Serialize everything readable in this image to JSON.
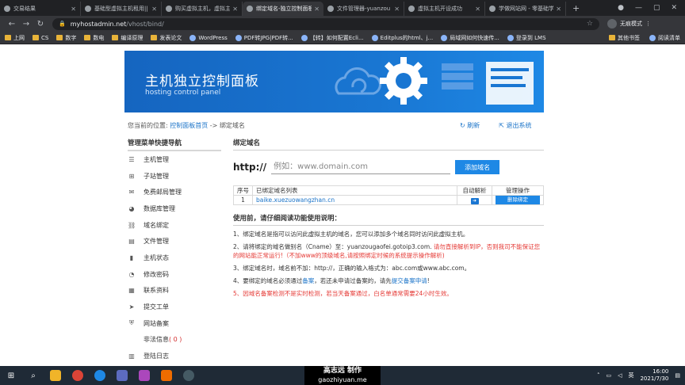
{
  "browser": {
    "tabs": [
      {
        "title": "交易结果",
        "active": false
      },
      {
        "title": "基础型虚拟主机租用||",
        "active": false
      },
      {
        "title": "购买虚拟主机，虚拟主",
        "active": false
      },
      {
        "title": "绑定域名-独立控制面板",
        "active": true
      },
      {
        "title": "文件管理器-yuanzou",
        "active": false
      },
      {
        "title": "虚拟主机开设成功",
        "active": false
      },
      {
        "title": "学做网站网 - 零基础学",
        "active": false
      }
    ],
    "newtab": "+",
    "url_host": "myhostadmin.net",
    "url_path": "/vhost/bind/",
    "profile_label": "无痕模式",
    "bookmarks": [
      "上网",
      "CS",
      "数字",
      "数电",
      "编译原理",
      "发表论文",
      "WordPress",
      "PDF转JPG|PDF转...",
      "【转】如何配置Ecli...",
      "Editplus的html、j...",
      "局域网如何快速传...",
      "登录到 LMS"
    ],
    "bookmarks_right": [
      "其他书签",
      "阅读清单"
    ]
  },
  "banner": {
    "title": "主机独立控制面板",
    "subtitle": "hosting control panel"
  },
  "breadcrumb": {
    "prefix": "您当前的位置:",
    "link": "控制面板首页",
    "sep": " -> ",
    "current": "绑定域名"
  },
  "toplinks": {
    "refresh": "刷新",
    "logout": "退出系统"
  },
  "sidebar": {
    "title": "管理菜单快捷导航",
    "items": [
      {
        "label": "主机管理",
        "icon": "database-icon"
      },
      {
        "label": "子站管理",
        "icon": "sitemap-icon"
      },
      {
        "label": "免费邮局管理",
        "icon": "envelope-icon"
      },
      {
        "label": "数据库管理",
        "icon": "pie-chart-icon"
      },
      {
        "label": "域名绑定",
        "icon": "link-icon"
      },
      {
        "label": "文件管理",
        "icon": "file-icon"
      },
      {
        "label": "主机状态",
        "icon": "status-icon"
      },
      {
        "label": "修改密码",
        "icon": "key-icon"
      },
      {
        "label": "联系资料",
        "icon": "contact-icon"
      },
      {
        "label": "提交工单",
        "icon": "send-icon"
      },
      {
        "label": "网站备案",
        "icon": "shield-icon"
      },
      {
        "label": "非法信息",
        "icon": "",
        "count": "( 0 )"
      },
      {
        "label": "登陆日志",
        "icon": "log-icon"
      }
    ]
  },
  "main": {
    "title": "绑定域名",
    "protocol": "http://",
    "input_placeholder": "例如：www.domain.com",
    "add_button": "添加域名",
    "table": {
      "headers": [
        "序号",
        "已绑定域名列表",
        "自动解析",
        "管理操作"
      ],
      "rows": [
        {
          "index": "1",
          "domain": "baike.xuezuowangzhan.cn",
          "action": "删除绑定"
        }
      ]
    },
    "notes_title": "使用前，请仔细阅读功能使用说明：",
    "notes": {
      "n1": "1、绑定域名是指可以访问此虚拟主机的域名，您可以添加多个域名同时访问此虚拟主机。",
      "n2a": "2、请将绑定的域名做别名（Cname）至：yuanzougaofei.gotoip3.com.",
      "n2b": " 请勿直接解析到IP，否则我司不能保证您的网站能正常运行!（不加www的顶级域名,请按照绑定时候的系统提示操作解析)",
      "n3": "3、绑定域名时，域名前不加：http://，正确的输入格式为：abc.com或www.abc.com。",
      "n4a": "4、要绑定的域名必须通过",
      "n4b": "备案",
      "n4c": "，若还未申请过备案的，请先",
      "n4d": "提交备案申请",
      "n4e": "!",
      "n5": "5、因域名备案检测不是实时检测，若当天备案通过，白名单通常需要24小时生效。"
    }
  },
  "taskbar": {
    "watermark_line1": "高志远 制作",
    "watermark_line2": "gaozhiyuan.me",
    "time": "16:00",
    "date": "2021/7/30",
    "lang": "英"
  }
}
